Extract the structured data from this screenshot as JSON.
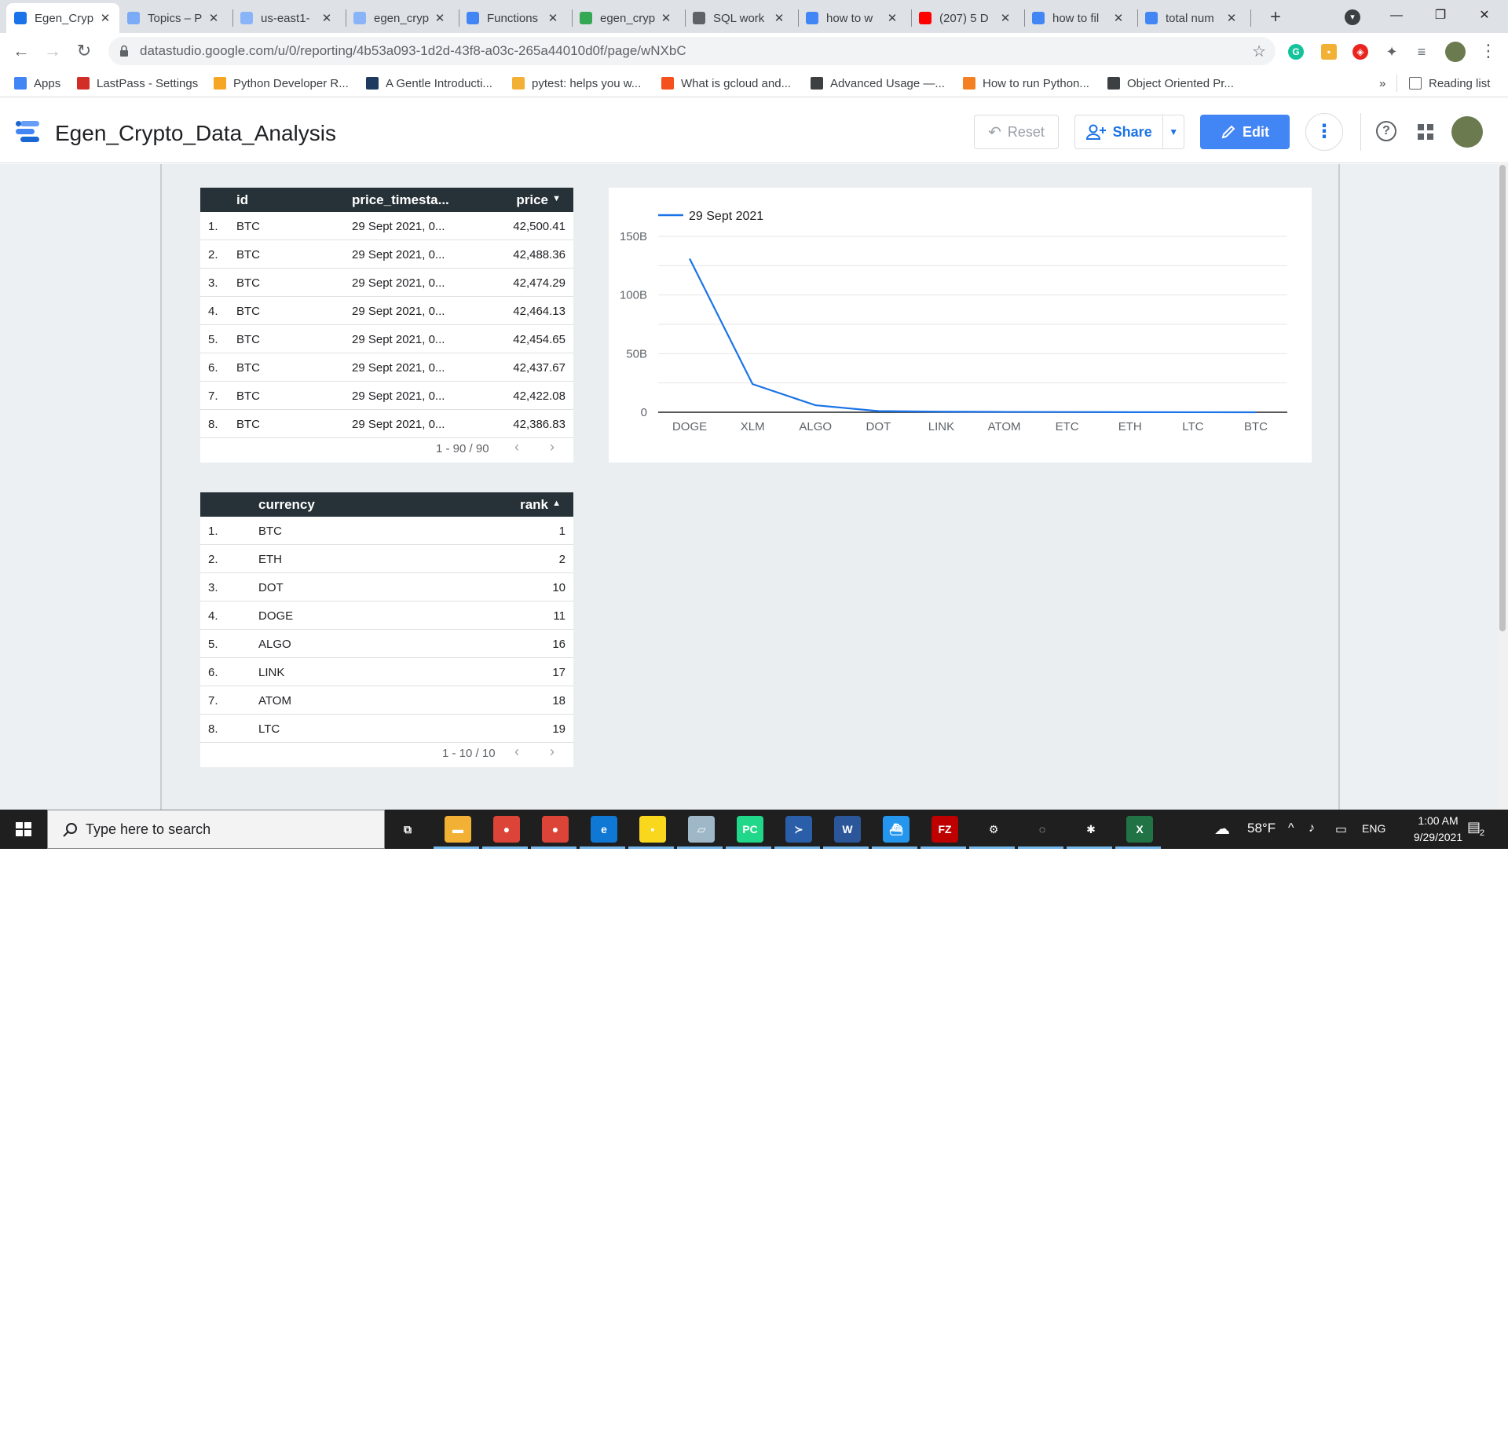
{
  "browser": {
    "tabs": [
      {
        "label": "Egen_Cryp",
        "color": "#1a73e8",
        "active": true
      },
      {
        "label": "Topics – P",
        "color": "#7baaf7"
      },
      {
        "label": "us-east1-",
        "color": "#8ab4f8"
      },
      {
        "label": "egen_cryp",
        "color": "#8ab4f8"
      },
      {
        "label": "Functions",
        "color": "#4285f4"
      },
      {
        "label": "egen_cryp",
        "color": "#34a853"
      },
      {
        "label": "SQL work",
        "color": "#5f6368"
      },
      {
        "label": "how to w",
        "color": "#4285f4"
      },
      {
        "label": "(207) 5 D",
        "color": "#ff0000"
      },
      {
        "label": "how to fil",
        "color": "#4285f4"
      },
      {
        "label": "total num",
        "color": "#4285f4"
      }
    ],
    "close_glyph": "✕",
    "new_tab_glyph": "+",
    "url": "datastudio.google.com/u/0/reporting/4b53a093-1d2d-43f8-a03c-265a44010d0f/page/wNXbC",
    "bookmarks": [
      {
        "label": "Apps",
        "color": "#4285f4"
      },
      {
        "label": "LastPass - Settings",
        "color": "#d32d27"
      },
      {
        "label": "Python Developer R...",
        "color": "#f5a623"
      },
      {
        "label": "A Gentle Introducti...",
        "color": "#1e3a5f"
      },
      {
        "label": "pytest: helps you w...",
        "color": "#f2b134"
      },
      {
        "label": "What is gcloud and...",
        "color": "#f4511e"
      },
      {
        "label": "Advanced Usage —...",
        "color": "#3c4043"
      },
      {
        "label": "How to run Python...",
        "color": "#f48024"
      },
      {
        "label": "Object Oriented Pr...",
        "color": "#3c4043"
      }
    ],
    "bookmarks_overflow": "»",
    "reading_list": "Reading list"
  },
  "header": {
    "title": "Egen_Crypto_Data_Analysis",
    "reset_label": "Reset",
    "share_label": "Share",
    "edit_label": "Edit",
    "help_glyph": "?"
  },
  "price_table": {
    "columns": [
      "id",
      "price_timesta...",
      "price"
    ],
    "sort_indicator": "▼",
    "rows": [
      {
        "n": "1.",
        "id": "BTC",
        "ts": "29 Sept 2021, 0...",
        "price": "42,500.41"
      },
      {
        "n": "2.",
        "id": "BTC",
        "ts": "29 Sept 2021, 0...",
        "price": "42,488.36"
      },
      {
        "n": "3.",
        "id": "BTC",
        "ts": "29 Sept 2021, 0...",
        "price": "42,474.29"
      },
      {
        "n": "4.",
        "id": "BTC",
        "ts": "29 Sept 2021, 0...",
        "price": "42,464.13"
      },
      {
        "n": "5.",
        "id": "BTC",
        "ts": "29 Sept 2021, 0...",
        "price": "42,454.65"
      },
      {
        "n": "6.",
        "id": "BTC",
        "ts": "29 Sept 2021, 0...",
        "price": "42,437.67"
      },
      {
        "n": "7.",
        "id": "BTC",
        "ts": "29 Sept 2021, 0...",
        "price": "42,422.08"
      },
      {
        "n": "8.",
        "id": "BTC",
        "ts": "29 Sept 2021, 0...",
        "price": "42,386.83"
      }
    ],
    "pagination": "1 - 90 / 90"
  },
  "rank_table": {
    "columns": [
      "currency",
      "rank"
    ],
    "sort_indicator": "▲",
    "rows": [
      {
        "n": "1.",
        "currency": "BTC",
        "rank": "1"
      },
      {
        "n": "2.",
        "currency": "ETH",
        "rank": "2"
      },
      {
        "n": "3.",
        "currency": "DOT",
        "rank": "10"
      },
      {
        "n": "4.",
        "currency": "DOGE",
        "rank": "11"
      },
      {
        "n": "5.",
        "currency": "ALGO",
        "rank": "16"
      },
      {
        "n": "6.",
        "currency": "LINK",
        "rank": "17"
      },
      {
        "n": "7.",
        "currency": "ATOM",
        "rank": "18"
      },
      {
        "n": "8.",
        "currency": "LTC",
        "rank": "19"
      }
    ],
    "pagination": "1 - 10 / 10"
  },
  "chart_data": {
    "type": "line",
    "categories": [
      "DOGE",
      "XLM",
      "ALGO",
      "DOT",
      "LINK",
      "ATOM",
      "ETC",
      "ETH",
      "LTC",
      "BTC"
    ],
    "series": [
      {
        "name": "29 Sept 2021",
        "color": "#1a73e8",
        "values": [
          131,
          24,
          6,
          1,
          0.5,
          0.3,
          0.2,
          0.1,
          0.05,
          0.02
        ]
      }
    ],
    "y_ticks": [
      0,
      50,
      100,
      150
    ],
    "y_tick_labels": [
      "0",
      "50B",
      "100B",
      "150B"
    ],
    "ylim": [
      0,
      150
    ],
    "grid": true,
    "legend_position": "top-left"
  },
  "taskbar": {
    "search_placeholder": "Type here to search",
    "temperature": "58°F",
    "language": "ENG",
    "time": "1:00 AM",
    "date": "9/29/2021",
    "notification_count": "2",
    "apps": [
      {
        "name": "task-view",
        "glyph": "⧉",
        "color": "#1f1f1f"
      },
      {
        "name": "file-explorer",
        "glyph": "▬",
        "color": "#f2b134"
      },
      {
        "name": "chrome",
        "glyph": "●",
        "color": "#db4437"
      },
      {
        "name": "chrome-active",
        "glyph": "●",
        "color": "#db4437"
      },
      {
        "name": "edge",
        "glyph": "e",
        "color": "#0f78d4"
      },
      {
        "name": "sticky-notes",
        "glyph": "▪",
        "color": "#f9d71c"
      },
      {
        "name": "notepad",
        "glyph": "▱",
        "color": "#9fb8c8"
      },
      {
        "name": "pycharm",
        "glyph": "PC",
        "color": "#21d789"
      },
      {
        "name": "powershell",
        "glyph": "≻",
        "color": "#2a5ea8"
      },
      {
        "name": "word",
        "glyph": "W",
        "color": "#2b579a"
      },
      {
        "name": "docker",
        "glyph": "⛴",
        "color": "#2496ed"
      },
      {
        "name": "filezilla",
        "glyph": "FZ",
        "color": "#bf0000"
      },
      {
        "name": "settings",
        "glyph": "⚙",
        "color": "#1f1f1f"
      },
      {
        "name": "sync-app",
        "glyph": "◌",
        "color": "#1f1f1f"
      },
      {
        "name": "spider-app",
        "glyph": "✱",
        "color": "#1f1f1f"
      },
      {
        "name": "excel",
        "glyph": "X",
        "color": "#217346"
      }
    ]
  }
}
